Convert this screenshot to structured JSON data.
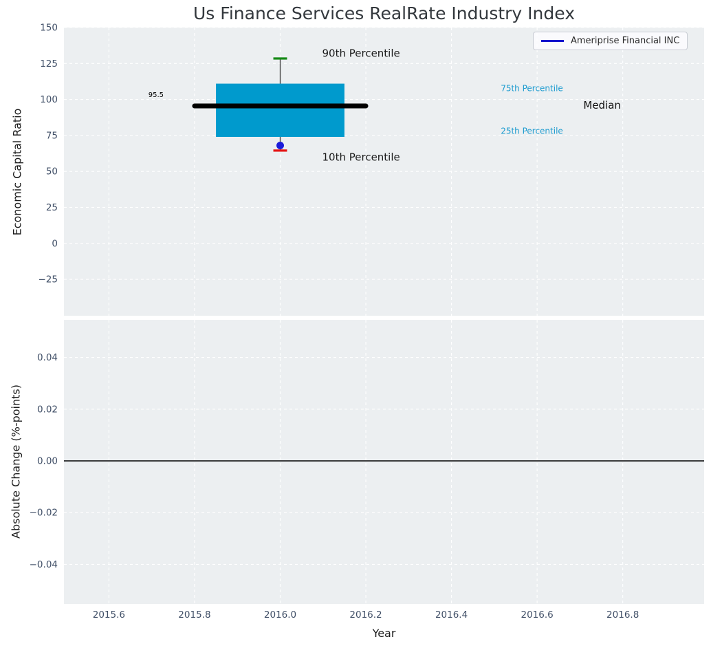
{
  "title": "Us Finance Services RealRate Industry Index",
  "legend": {
    "label": "Ameriprise Financial INC"
  },
  "chart_data": {
    "type": "boxplot",
    "title": "Us Finance Services RealRate Industry Index",
    "x_axis": {
      "label": "Year",
      "range": [
        2015.495,
        2016.99
      ],
      "ticks": [
        {
          "value": 2015.6,
          "label": "2015.6"
        },
        {
          "value": 2015.8,
          "label": "2015.8"
        },
        {
          "value": 2016.0,
          "label": "2016.0"
        },
        {
          "value": 2016.2,
          "label": "2016.2"
        },
        {
          "value": 2016.4,
          "label": "2016.4"
        },
        {
          "value": 2016.6,
          "label": "2016.6"
        },
        {
          "value": 2016.8,
          "label": "2016.8"
        }
      ]
    },
    "top_panel": {
      "ylabel": "Economic Capital Ratio",
      "range": [
        -50.3,
        150
      ],
      "ticks": [
        {
          "value": 150,
          "label": "150"
        },
        {
          "value": 125,
          "label": "125"
        },
        {
          "value": 100,
          "label": "100"
        },
        {
          "value": 75,
          "label": "75"
        },
        {
          "value": 50,
          "label": "50"
        },
        {
          "value": 25,
          "label": "25"
        },
        {
          "value": 0,
          "label": "0"
        },
        {
          "value": -25,
          "label": "−25"
        }
      ],
      "box": {
        "year": 2016.0,
        "q1": 74,
        "median": 95.5,
        "q3": 111,
        "p10": 64.5,
        "p90": 128.5,
        "box_halfwidth_years": 0.15,
        "median_halfwidth_years": 0.2,
        "cap_halfwidth_years": 0.016
      },
      "company_point": {
        "name": "Ameriprise Financial INC",
        "year": 2016.0,
        "value": 68
      }
    },
    "bottom_panel": {
      "ylabel": "Absolute Change (%-points)",
      "range": [
        -0.0553,
        0.0545
      ],
      "zero_line": 0.0,
      "ticks": [
        {
          "value": 0.04,
          "label": "0.04"
        },
        {
          "value": 0.02,
          "label": "0.02"
        },
        {
          "value": 0.0,
          "label": "0.00"
        },
        {
          "value": -0.02,
          "label": "−0.02"
        },
        {
          "value": -0.04,
          "label": "−0.04"
        }
      ]
    },
    "annotations": [
      {
        "name": "median-value-label",
        "text": "95.5",
        "x": 2015.71,
        "y": 103.5,
        "size": 10,
        "color": "#000000",
        "anchor": "middle"
      },
      {
        "name": "p90-label",
        "text": "90th Percentile",
        "x": 2016.098,
        "y": 132.3,
        "size": 15,
        "color": "#1a1a1a",
        "anchor": "start"
      },
      {
        "name": "p10-label",
        "text": "10th Percentile",
        "x": 2016.098,
        "y": 60.0,
        "size": 15,
        "color": "#1a1a1a",
        "anchor": "start"
      },
      {
        "name": "p75-label",
        "text": "75th Percentile",
        "x": 2016.515,
        "y": 107.8,
        "size": 12,
        "color": "#1e9cd0",
        "anchor": "start"
      },
      {
        "name": "median-label",
        "text": "Median",
        "x": 2016.708,
        "y": 96.2,
        "size": 15,
        "color": "#111111",
        "anchor": "start"
      },
      {
        "name": "p25-label",
        "text": "25th Percentile",
        "x": 2016.515,
        "y": 78.2,
        "size": 12,
        "color": "#1e9cd0",
        "anchor": "start"
      }
    ],
    "style": {
      "axes_bg": "#eceff1",
      "grid": "#ffffff",
      "box_fill": "#009acd",
      "median_line": "#000000",
      "whisker": "#404040",
      "cap_top": "#178a17",
      "cap_bottom": "#e51313",
      "point": "#1b1bd9",
      "legend_line": "#1414cd",
      "tick_text": "#3f4e66",
      "zero_line": "#000000"
    },
    "legend": {
      "label": "Ameriprise Financial INC",
      "position": "upper right"
    },
    "grid": true
  }
}
